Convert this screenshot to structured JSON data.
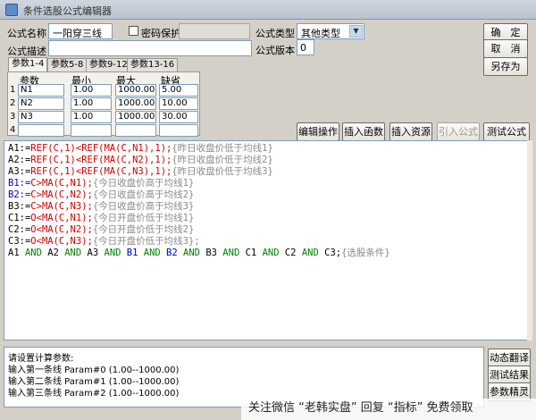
{
  "window": {
    "title": "条件选股公式编辑器"
  },
  "form": {
    "name_label": "公式名称",
    "name_value": "一阳穿三线",
    "password_label": "密码保护",
    "type_label": "公式类型",
    "type_value": "其他类型",
    "desc_label": "公式描述",
    "version_label": "公式版本",
    "version_value": "0"
  },
  "buttons": {
    "ok": "确　定",
    "cancel": "取　消",
    "save_as": "另存为",
    "edit_ops": "编辑操作",
    "insert_func": "插入函数",
    "insert_resource": "插入资源",
    "import_formula": "引入公式",
    "test_formula": "测试公式",
    "dynamic_translate": "动态翻译",
    "test_results": "测试结果",
    "param_tuning": "参数精灵"
  },
  "tabs": [
    {
      "label": "参数1-4"
    },
    {
      "label": "参数5-8"
    },
    {
      "label": "参数9-12"
    },
    {
      "label": "参数13-16"
    }
  ],
  "params": {
    "headers": [
      "参数",
      "最小",
      "最大",
      "缺省"
    ],
    "rows": [
      {
        "num": "1",
        "name": "N1",
        "min": "1.00",
        "max": "1000.00",
        "default": "5.00"
      },
      {
        "num": "2",
        "name": "N2",
        "min": "1.00",
        "max": "1000.00",
        "default": "10.00"
      },
      {
        "num": "3",
        "name": "N3",
        "min": "1.00",
        "max": "1000.00",
        "default": "30.00"
      },
      {
        "num": "4",
        "name": "",
        "min": "",
        "max": "",
        "default": ""
      }
    ]
  },
  "code": {
    "l1": {
      "a": "A1:=",
      "b": "REF(C,1)<REF(MA(C,N1),1);",
      "c": "{昨日收盘价低于均线1}"
    },
    "l2": {
      "a": "A2:=",
      "b": "REF(C,1)<REF(MA(C,N2),1);",
      "c": "{昨日收盘价低于均线2}"
    },
    "l3": {
      "a": "A3:=",
      "b": "REF(C,1)<REF(MA(C,N3),1);",
      "c": "{昨日收盘价低于均线3}"
    },
    "l4": {
      "a": "B1:=",
      "b": "C>MA(C,N1);",
      "c": "{今日收盘价高于均线1}"
    },
    "l5": {
      "a": "B2:=",
      "b": "C>MA(C,N2);",
      "c": "{今日收盘价高于均线2}"
    },
    "l6": {
      "a": "B3:=",
      "b": "C>MA(C,N3);",
      "c": "{今日收盘价高于均线3}"
    },
    "l7": {
      "a": "C1:=",
      "b": "O<MA(C,N1);",
      "c": "{今日开盘价低于均线1}"
    },
    "l8": {
      "a": "C2:=",
      "b": "O<MA(C,N2);",
      "c": "{今日开盘价低于均线2}"
    },
    "l9": {
      "a": "C3:=",
      "b": "O<MA(C,N3);",
      "c": "{今日开盘价低于均线3};"
    },
    "l10": {
      "a1": "A1 ",
      "and1": "AND",
      "a2": " A2 ",
      "and2": "AND",
      "a3": " A3 ",
      "and3": "AND",
      "b1": " B1 ",
      "and4": "AND",
      "b2": " B2 ",
      "and5": "AND",
      "b3": " B3 ",
      "and6": "AND",
      "c1": " C1 ",
      "and7": "AND",
      "c2": " C2 ",
      "and8": "AND",
      "c3": " C3;",
      "comment": "{选股条件}"
    }
  },
  "output": {
    "lines": [
      "请设置计算参数:",
      "输入第一条线 Param#0 (1.00--1000.00)",
      "输入第二条线 Param#1 (1.00--1000.00)",
      "输入第三条线 Param#2 (1.00--1000.00)"
    ]
  },
  "watermark": {
    "text": "关注微信 “老韩实盘” 回复 “指标” 免费领取"
  },
  "colors": {
    "keyword_red": "#d00000",
    "keyword_blue": "#0000d0",
    "keyword_green": "#008000",
    "comment_gray": "#8a8a8a"
  }
}
